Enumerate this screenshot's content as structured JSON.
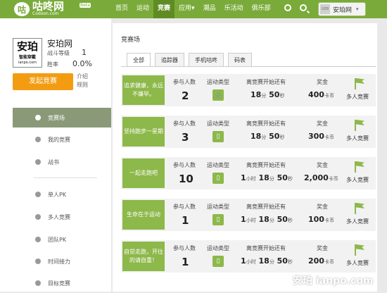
{
  "logo": {
    "mark": "咕",
    "name": "咕咚网",
    "domain": "Codoon.com",
    "beta": "Beta"
  },
  "nav": [
    {
      "label": "首页",
      "active": false
    },
    {
      "label": "运动",
      "active": false
    },
    {
      "label": "竞赛",
      "active": true
    },
    {
      "label": "应用▾",
      "active": false
    },
    {
      "label": "潮品",
      "active": false
    },
    {
      "label": "乐活动",
      "active": false
    },
    {
      "label": "俱乐部",
      "active": false
    }
  ],
  "user": {
    "avatar_text": "GEB",
    "name": "安珀网",
    "caret": "▾"
  },
  "profile": {
    "avatar_line1": "安珀",
    "avatar_line2": "智能穿戴",
    "avatar_line3": "ianpo.com",
    "name": "安珀网",
    "level_label": "战斗等级",
    "level_value": "1",
    "winrate_label": "胜率",
    "winrate_value": "0.0%"
  },
  "launch_button": "发起竞赛",
  "intro_link": {
    "line1": "介绍",
    "line2": "规则"
  },
  "sidebar": {
    "items": [
      {
        "label": "竞赛场",
        "icon": "arena-icon",
        "active": true
      },
      {
        "label": "我的竞赛",
        "icon": "star-icon",
        "active": false
      },
      {
        "label": "战书",
        "icon": "book-icon",
        "active": false
      },
      {
        "label": "单人PK",
        "icon": "person-icon",
        "active": false
      },
      {
        "label": "多人竞赛",
        "icon": "group-icon",
        "active": false
      },
      {
        "label": "团队PK",
        "icon": "team-icon",
        "active": false
      },
      {
        "label": "时间接力",
        "icon": "clock-icon",
        "active": false
      },
      {
        "label": "目标竞赛",
        "icon": "target-icon",
        "active": false
      }
    ]
  },
  "main": {
    "title": "竞赛场",
    "tabs": [
      {
        "label": "全部",
        "active": true
      },
      {
        "label": "追踪器",
        "active": false
      },
      {
        "label": "手机咕咚",
        "active": false
      },
      {
        "label": "码表",
        "active": false
      }
    ],
    "col_labels": {
      "participants": "参与人数",
      "type": "运动类型",
      "countdown": "离竞赛开始还有",
      "prize": "奖金"
    },
    "cards": [
      {
        "banner": "追求健康，永远不嫌早。",
        "count": "2",
        "type_icon": "bike-icon",
        "type_glyph": "🚲",
        "hours": "",
        "hour_unit": "",
        "minutes": "18",
        "minute_unit": "分",
        "seconds": "50",
        "second_unit": "秒",
        "prize": "400",
        "prize_unit": "卡币",
        "mode": "多人竞赛"
      },
      {
        "banner": "坚持跑步一星期",
        "count": "3",
        "type_icon": "phone-icon",
        "type_glyph": "▯",
        "hours": "",
        "hour_unit": "",
        "minutes": "18",
        "minute_unit": "分",
        "seconds": "50",
        "second_unit": "秒",
        "prize": "300",
        "prize_unit": "卡币",
        "mode": "多人竞赛"
      },
      {
        "banner": "一起走跑吧",
        "count": "10",
        "type_icon": "phone-icon",
        "type_glyph": "▯",
        "hours": "1",
        "hour_unit": "小时",
        "minutes": "18",
        "minute_unit": "分",
        "seconds": "50",
        "second_unit": "秒",
        "prize": "2,000",
        "prize_unit": "卡币",
        "mode": "多人竞赛"
      },
      {
        "banner": "生命在于运动",
        "count": "1",
        "type_icon": "phone-icon",
        "type_glyph": "▯",
        "hours": "1",
        "hour_unit": "小时",
        "minutes": "18",
        "minute_unit": "分",
        "seconds": "50",
        "second_unit": "秒",
        "prize": "100",
        "prize_unit": "卡币",
        "mode": "多人竞赛"
      },
      {
        "banner": "自觉走跑，开往的请自重！",
        "count": "1",
        "type_icon": "phone-icon",
        "type_glyph": "▯",
        "hours": "1",
        "hour_unit": "小时",
        "minutes": "18",
        "minute_unit": "分",
        "seconds": "50",
        "second_unit": "秒",
        "prize": "200",
        "prize_unit": "卡币",
        "mode": "多人竞赛"
      }
    ]
  },
  "watermark": "安珀 ianpo.com",
  "colors": {
    "brand": "#7aab3a",
    "nav_active": "#5e8c22",
    "accent": "#f39c12",
    "card_green": "#8db84a"
  }
}
